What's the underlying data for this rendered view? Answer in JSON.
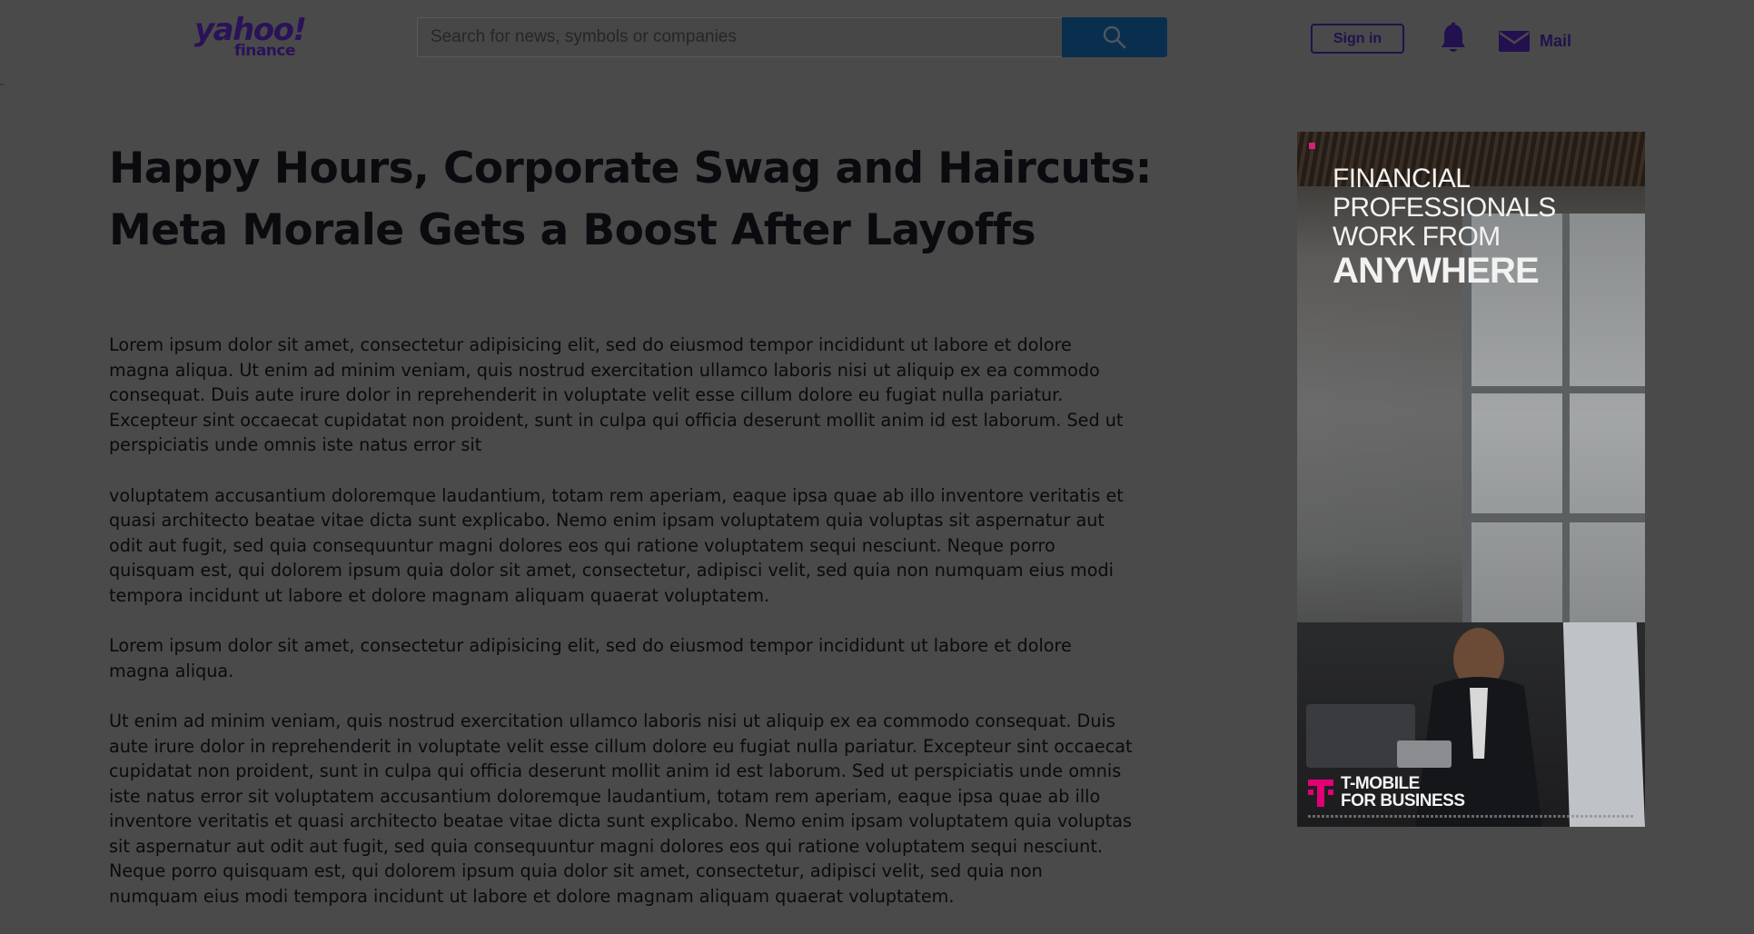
{
  "header": {
    "logo_primary": "yahoo!",
    "logo_secondary": "finance",
    "search_placeholder": "Search for news, symbols or companies",
    "search_icon": "search-icon",
    "sign_in_label": "Sign in",
    "notifications_icon": "bell-icon",
    "mail_icon": "envelope-icon",
    "mail_label": "Mail"
  },
  "article": {
    "headline": "Happy Hours, Corporate Swag and Haircuts: Meta Morale Gets a Boost After Layoffs",
    "paragraphs": [
      "Lorem ipsum dolor sit amet, consectetur adipisicing elit, sed do eiusmod tempor incididunt ut labore et dolore magna aliqua. Ut enim ad minim veniam, quis nostrud exercitation ullamco laboris nisi ut aliquip ex ea commodo consequat. Duis aute irure dolor in reprehenderit in voluptate velit esse cillum dolore eu fugiat nulla pariatur. Excepteur sint occaecat cupidatat non proident, sunt in culpa qui officia deserunt mollit anim id est laborum. Sed ut perspiciatis unde omnis iste natus error sit",
      "voluptatem accusantium doloremque laudantium, totam rem aperiam, eaque ipsa quae ab illo inventore veritatis et quasi architecto beatae vitae dicta sunt explicabo. Nemo enim ipsam voluptatem quia voluptas sit aspernatur aut odit aut fugit, sed quia consequuntur magni dolores eos qui ratione voluptatem sequi nesciunt. Neque porro quisquam est, qui dolorem ipsum quia dolor sit amet, consectetur, adipisci velit, sed quia non numquam eius modi tempora incidunt ut labore et dolore magnam aliquam quaerat voluptatem.",
      "Lorem ipsum dolor sit amet, consectetur adipisicing elit, sed do eiusmod tempor incididunt ut labore et dolore magna aliqua.",
      "Ut enim ad minim veniam, quis nostrud exercitation ullamco laboris nisi ut aliquip ex ea commodo consequat. Duis aute irure dolor in reprehenderit in voluptate velit esse cillum dolore eu fugiat nulla pariatur. Excepteur sint occaecat cupidatat non proident, sunt in culpa qui officia deserunt mollit anim id est laborum. Sed ut perspiciatis unde omnis iste natus error sit voluptatem accusantium doloremque laudantium, totam rem aperiam, eaque ipsa quae ab illo inventore veritatis et quasi architecto beatae vitae dicta sunt explicabo. Nemo enim ipsam voluptatem quia voluptas sit aspernatur aut odit aut fugit, sed quia consequuntur magni dolores eos qui ratione voluptatem sequi nesciunt. Neque porro quisquam est, qui dolorem ipsum quia dolor sit amet, consectetur, adipisci velit, sed quia non numquam eius modi tempora incidunt ut labore et dolore magnam aliquam quaerat voluptatem."
    ]
  },
  "ad": {
    "headline_lines": [
      "FINANCIAL",
      "PROFESSIONALS",
      "WORK FROM"
    ],
    "headline_emphasis": "ANYWHERE",
    "brand_logo": "t-mobile-logo",
    "brand_line1": "T-MOBILE",
    "brand_line2": "FOR BUSINESS"
  },
  "colors": {
    "overlay_background": "#4a4a4a",
    "brand_purple": "#23104e",
    "search_button": "#0a2f4e",
    "ad_accent": "#d2237c"
  }
}
